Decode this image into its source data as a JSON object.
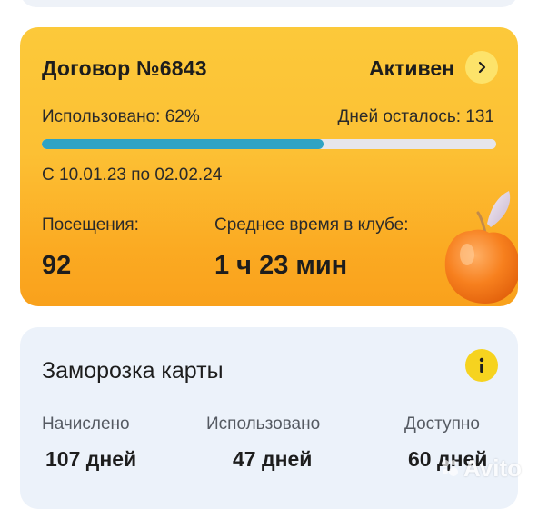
{
  "contract": {
    "title": "Договор №6843",
    "status": "Активен",
    "used_label": "Использовано: 62%",
    "used_fraction": 0.62,
    "days_left_label": "Дней осталось: 131",
    "period": "С 10.01.23 по 02.02.24",
    "visits_label": "Посещения:",
    "visits_value": "92",
    "avg_time_label": "Среднее время в клубе:",
    "avg_time_value": "1 ч 23 мин",
    "progress_color": "#2fa3c4",
    "card_color": "#fcc034"
  },
  "freeze": {
    "title": "Заморозка карты",
    "columns": [
      {
        "label": "Начислено",
        "value": "107 дней"
      },
      {
        "label": "Использовано",
        "value": "47 дней"
      },
      {
        "label": "Доступно",
        "value": "60 дней"
      }
    ]
  },
  "icons": {
    "status_arrow": "chevron-right-icon",
    "info": "info-icon",
    "decoration": "peach-icon",
    "watermark": "avito-logo"
  },
  "watermark": {
    "text": "Avito"
  }
}
